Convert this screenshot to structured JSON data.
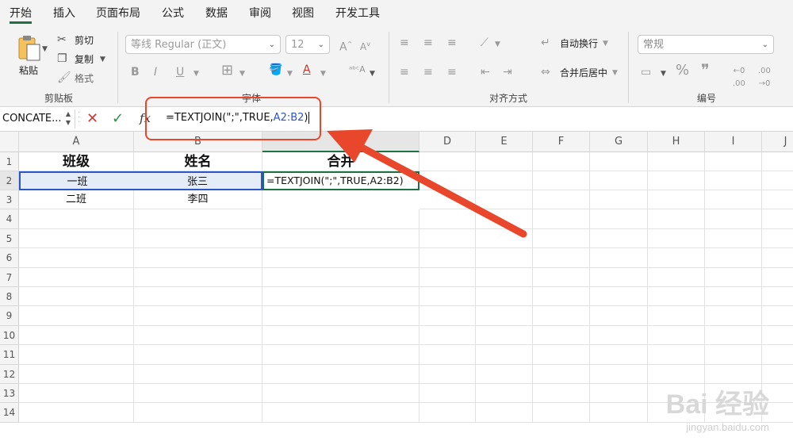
{
  "tabs": [
    "开始",
    "插入",
    "页面布局",
    "公式",
    "数据",
    "审阅",
    "视图",
    "开发工具"
  ],
  "clipboard": {
    "paste": "粘贴",
    "cut": "剪切",
    "copy": "复制",
    "format": "格式",
    "label": "剪贴板"
  },
  "font": {
    "name": "等线 Regular (正文)",
    "size": "12",
    "label": "字体"
  },
  "align": {
    "wrap": "自动换行",
    "merge": "合并后居中",
    "label": "对齐方式"
  },
  "number": {
    "format": "常规",
    "label": "编号"
  },
  "formula_bar": {
    "name_box": "CONCATE...",
    "fx": "fx",
    "formula_plain": "=TEXTJOIN(\";\",TRUE,",
    "formula_ref": "A2:B2",
    "formula_close": ")"
  },
  "columns": [
    "A",
    "B",
    "C",
    "D",
    "E",
    "F",
    "G",
    "H",
    "I",
    "J"
  ],
  "rows": [
    "1",
    "2",
    "3",
    "4",
    "5",
    "6",
    "7",
    "8",
    "9",
    "10",
    "11",
    "12",
    "13",
    "14"
  ],
  "cells": {
    "A1": "班级",
    "B1": "姓名",
    "C1": "合并",
    "A2": "一班",
    "B2": "张三",
    "C2": "=TEXTJOIN(\";\",TRUE,A2:B2)",
    "A3": "二班",
    "B3": "李四"
  },
  "watermark": {
    "main": "Bai 经验",
    "sub": "jingyan.baidu.com"
  },
  "colors": {
    "accent": "#1e7145",
    "highlight": "#e8472b",
    "ref": "#2a56c6"
  }
}
